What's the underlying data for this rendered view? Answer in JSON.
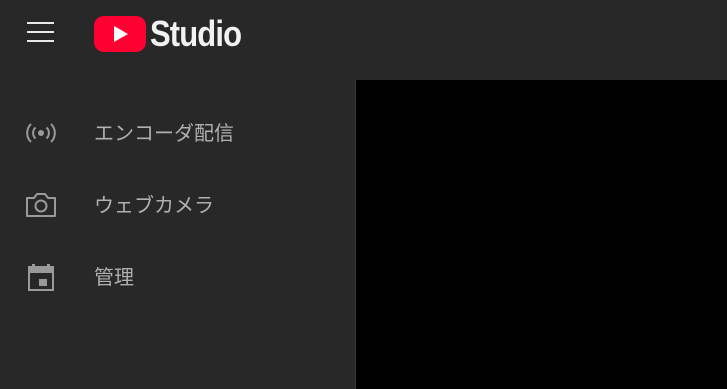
{
  "app": {
    "logo_text": "Studio"
  },
  "topbar": {
    "menu_icon": "hamburger-menu-icon",
    "logo_icon": "youtube-play-icon"
  },
  "sidebar": {
    "items": [
      {
        "label": "エンコーダ配信",
        "icon": "broadcast-icon"
      },
      {
        "label": "ウェブカメラ",
        "icon": "camera-icon"
      },
      {
        "label": "管理",
        "icon": "calendar-icon"
      }
    ]
  },
  "colors": {
    "topbar_bg": "#282828",
    "sidebar_bg": "#282828",
    "preview_bg": "#000000",
    "logo_red": "#ff0033",
    "label_text": "#b0b0b0"
  }
}
